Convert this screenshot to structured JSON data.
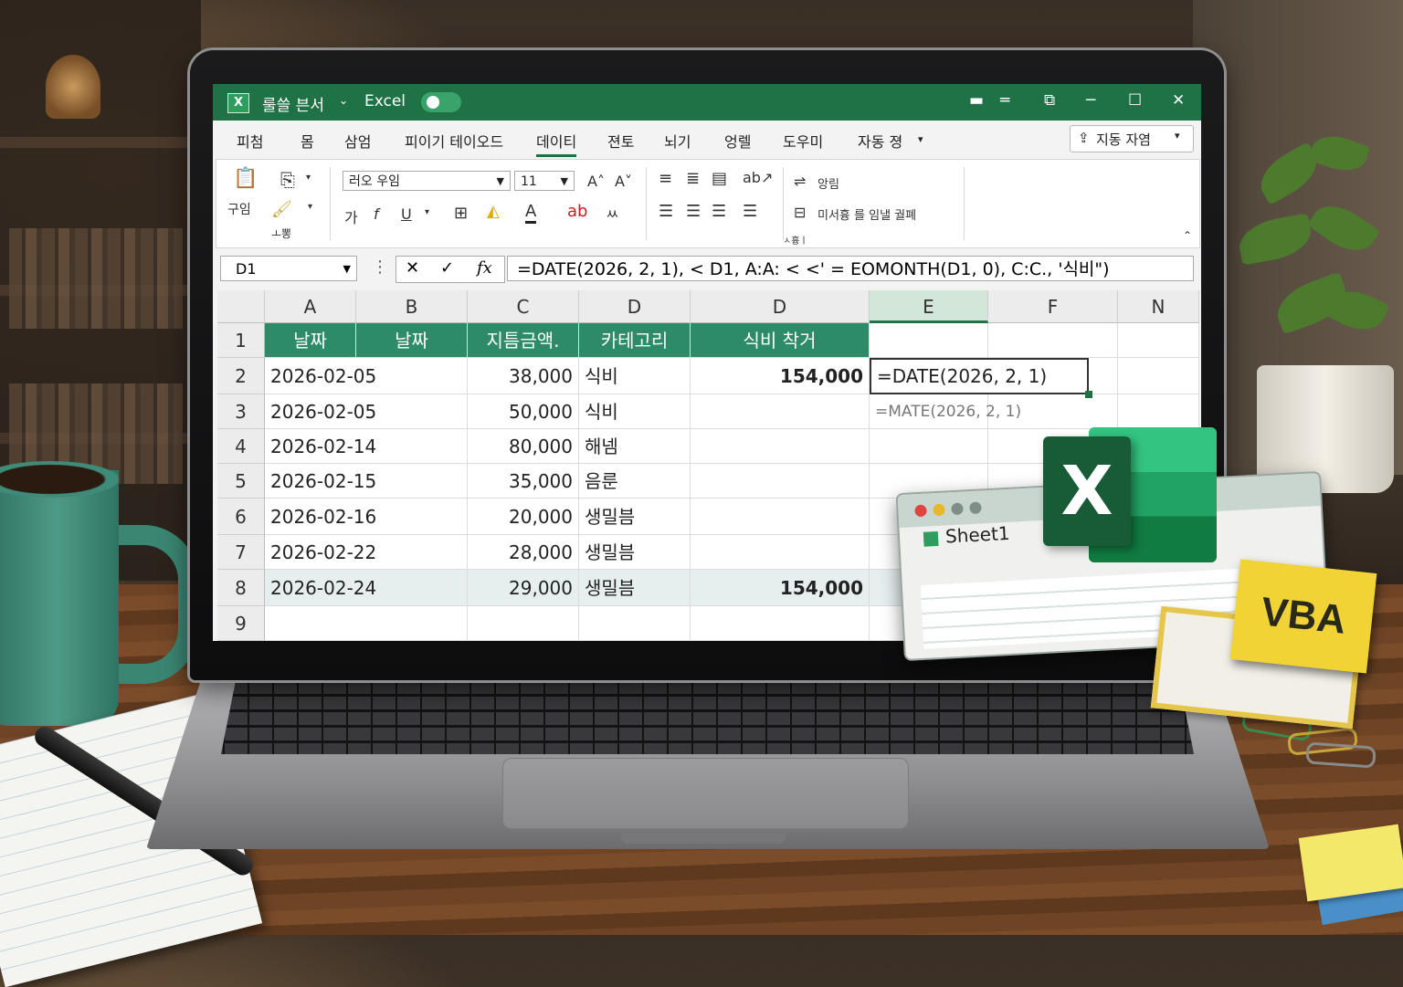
{
  "window": {
    "doc_title": "룰쓸 븐서",
    "app_name": "Excel",
    "share_label": "지동 자염"
  },
  "menu": [
    "피첨",
    "몸",
    "삼엄",
    "피이기 테이오드",
    "데이티",
    "젼토",
    "뇌기",
    "엉렐",
    "도우미",
    "자동 졍"
  ],
  "ribbon": {
    "clipboard_label": "구임",
    "font_name": "러오 우임",
    "font_size": "11",
    "bold_label": "가",
    "italic_label": "f",
    "underline_label": "U",
    "wrap_label": "앙림",
    "merge_label": "미서흉 를 임낼 궐폐",
    "style_label": "ㅗ뽕",
    "group_label": "ㅅ흉ㅣ"
  },
  "formula_bar": {
    "name_box": "D1",
    "formula": "=DATE(2026, 2, 1), < D1,  A:A: < <' = EOMONTH(D1,  0), C:C., '식비\")"
  },
  "columns": [
    "A",
    "B",
    "C",
    "D",
    "D",
    "E",
    "F",
    "N"
  ],
  "rows": [
    "1",
    "2",
    "3",
    "4",
    "5",
    "6",
    "7",
    "8",
    "9"
  ],
  "header_row": [
    "날짜",
    "날짜",
    "지틈금액.",
    "카테고리",
    "식비 착거"
  ],
  "data_rows": [
    {
      "date": "2026-02-05",
      "amount": "38,000",
      "category": "식비",
      "total": "154,000"
    },
    {
      "date": "2026-02-05",
      "amount": "50,000",
      "category": "식비",
      "total": ""
    },
    {
      "date": "2026-02-14",
      "amount": "80,000",
      "category": "해넴",
      "total": ""
    },
    {
      "date": "2026-02-15",
      "amount": "35,000",
      "category": "음룬",
      "total": ""
    },
    {
      "date": "2026-02-16",
      "amount": "20,000",
      "category": "생밀븜",
      "total": ""
    },
    {
      "date": "2026-02-22",
      "amount": "28,000",
      "category": "생밀븜",
      "total": ""
    },
    {
      "date": "2026-02-24",
      "amount": "29,000",
      "category": "생밀븜",
      "total": "154,000"
    }
  ],
  "active_cell_text": "=DATE(2026, 2, 1)",
  "ghost_cell_text": "=MATE(2026, 2, 1)",
  "overlay": {
    "sheet_tab": "Sheet1",
    "excel_logo": "X",
    "vba_label": "VBA"
  }
}
